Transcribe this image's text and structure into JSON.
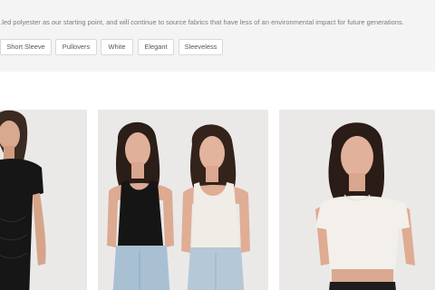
{
  "collection": {
    "description": "...led polyester as our starting point, and will continue to source fabrics that have less of an environmental impact for future generations."
  },
  "tags": [
    {
      "label": "Short Sleeve"
    },
    {
      "label": "Pullovers"
    },
    {
      "label": "White"
    },
    {
      "label": "Elegant"
    },
    {
      "label": "Sleeveless"
    }
  ],
  "products": [
    {
      "image": "model in black short-sleeve ruched dress",
      "color": "#1a1a1a"
    },
    {
      "image": "two models in black and white tank tops with jeans",
      "colors": [
        "#1c1c1c",
        "#efece6"
      ]
    },
    {
      "image": "model in white short-sleeve crop top",
      "color": "#f1eee9"
    }
  ],
  "colors": {
    "band": "#f4f4f4",
    "card_bg": "#ebe9e8",
    "tag_border": "#d9d9d9",
    "text_muted": "#7a7a7a"
  }
}
